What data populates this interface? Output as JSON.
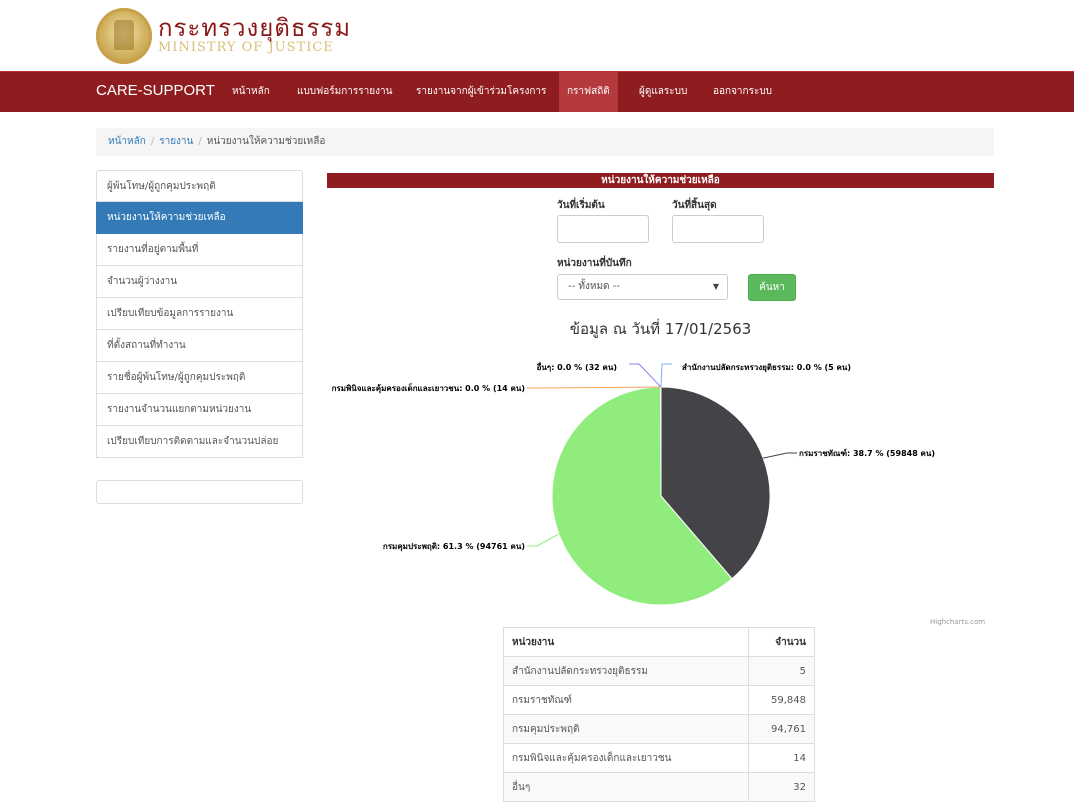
{
  "header": {
    "title_th": "กระทรวงยุติธรรม",
    "title_en": "MINISTRY OF JUSTICE"
  },
  "navbar": {
    "brand": "CARE-SUPPORT",
    "items": [
      {
        "label": "หน้าหลัก",
        "active": false
      },
      {
        "label": "แบบฟอร์มการรายงาน",
        "active": false
      },
      {
        "label": "รายงานจากผู้เข้าร่วมโครงการ",
        "active": false
      },
      {
        "label": "กราฟสถิติ",
        "active": true
      },
      {
        "label": "ผู้ดูแลระบบ",
        "active": false
      },
      {
        "label": "ออกจากระบบ",
        "active": false
      }
    ]
  },
  "breadcrumb": {
    "items": [
      "หน้าหลัก",
      "รายงาน",
      "หน่วยงานให้ความช่วยเหลือ"
    ]
  },
  "sidebar": {
    "items": [
      {
        "label": "ผู้พ้นโทษ/ผู้ถูกคุมประพฤติ",
        "active": false
      },
      {
        "label": "หน่วยงานให้ความช่วยเหลือ",
        "active": true
      },
      {
        "label": "รายงานที่อยู่ตามพื้นที่",
        "active": false
      },
      {
        "label": "จำนวนผู้ว่างงาน",
        "active": false
      },
      {
        "label": "เปรียบเทียบข้อมูลการรายงาน",
        "active": false
      },
      {
        "label": "ที่ตั้งสถานที่ทำงาน",
        "active": false
      },
      {
        "label": "รายชื่อผู้พ้นโทษ/ผู้ถูกคุมประพฤติ",
        "active": false
      },
      {
        "label": "รายงานจำนวนแยกตามหน่วยงาน",
        "active": false
      },
      {
        "label": "เปรียบเทียบการติดตามและจำนวนปล่อย",
        "active": false
      }
    ]
  },
  "main": {
    "section_title": "หน่วยงานให้ความช่วยเหลือ",
    "start_date_label": "วันที่เริ่มต้น",
    "end_date_label": "วันที่สิ้นสุด",
    "start_date_value": "",
    "end_date_value": "",
    "agency_label": "หน่วยงานที่บันทึก",
    "agency_selected": "-- ทั้งหมด --",
    "search_button": "ค้นหา",
    "data_date": "ข้อมูล ณ วันที่ 17/01/2563",
    "credits": "Highcharts.com"
  },
  "chart_data": {
    "type": "pie",
    "slices": [
      {
        "name": "กรมราชทัณฑ์",
        "percent": 38.7,
        "count": 59848,
        "label": "กรมราชทัณฑ์: 38.7 % (59848 คน)",
        "color": "#434348"
      },
      {
        "name": "กรมคุมประพฤติ",
        "percent": 61.3,
        "count": 94761,
        "label": "กรมคุมประพฤติ: 61.3 % (94761 คน)",
        "color": "#90ed7d"
      },
      {
        "name": "กรมพินิจและคุ้มครองเด็กและเยาวชน",
        "percent": 0.0,
        "count": 14,
        "label": "กรมพินิจและคุ้มครองเด็กและเยาวชน: 0.0 % (14 คน)",
        "color": "#f7a35c"
      },
      {
        "name": "อื่นๆ",
        "percent": 0.0,
        "count": 32,
        "label": "อื่นๆ: 0.0 % (32 คน)",
        "color": "#8085e9"
      },
      {
        "name": "สำนักงานปลัดกระทรวงยุติธรรม",
        "percent": 0.0,
        "count": 5,
        "label": "สำนักงานปลัดกระทรวงยุติธรรม: 0.0 % (5 คน)",
        "color": "#7cb5ec"
      }
    ]
  },
  "table": {
    "headers": [
      "หน่วยงาน",
      "จำนวน"
    ],
    "rows": [
      [
        "สำนักงานปลัดกระทรวงยุติธรรม",
        "5"
      ],
      [
        "กรมราชทัณฑ์",
        "59,848"
      ],
      [
        "กรมคุมประพฤติ",
        "94,761"
      ],
      [
        "กรมพินิจและคุ้มครองเด็กและเยาวชน",
        "14"
      ],
      [
        "อื่นๆ",
        "32"
      ]
    ]
  }
}
